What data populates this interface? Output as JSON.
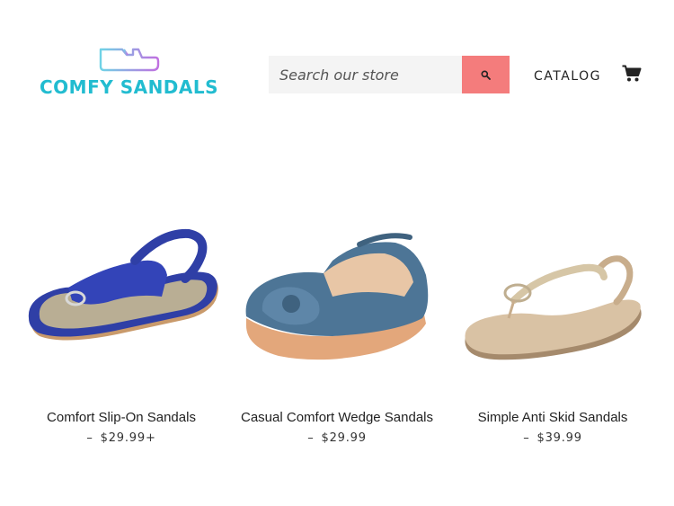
{
  "header": {
    "logo_text": "COMFY SANDALS",
    "search_placeholder": "Search our store",
    "nav_catalog": "CATALOG",
    "icons": {
      "search": "search-icon",
      "cart": "cart-icon"
    }
  },
  "products": [
    {
      "title": "Comfort Slip-On Sandals",
      "dash": "–",
      "price": "$29.99",
      "suffix": "+"
    },
    {
      "title": "Casual Comfort Wedge Sandals",
      "dash": "–",
      "price": "$29.99",
      "suffix": ""
    },
    {
      "title": "Simple Anti Skid Sandals",
      "dash": "–",
      "price": "$39.99",
      "suffix": ""
    }
  ],
  "colors": {
    "logo_text": "#22bcd0",
    "search_button": "#f47c7c",
    "search_background": "#f4f4f4"
  }
}
